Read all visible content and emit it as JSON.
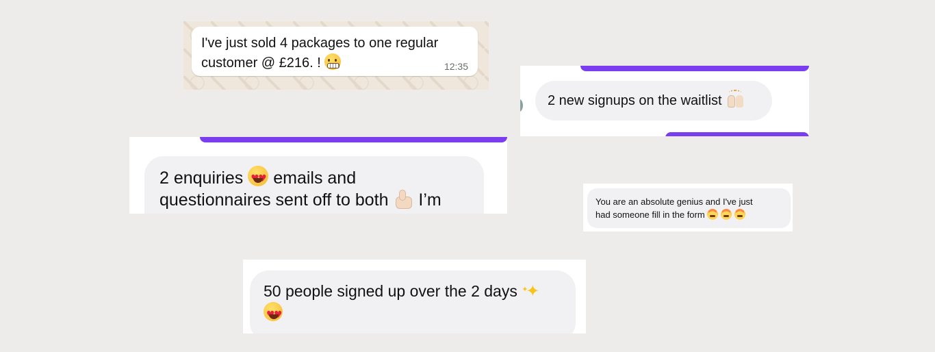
{
  "messages": {
    "whatsapp": {
      "line1": "I've just sold 4 packages to one regular",
      "line2": "customer @ £216. !",
      "emoji": "grimacing-face",
      "time": "12:35"
    },
    "waitlist": {
      "text": "2 new signups on the waitlist",
      "emoji": "raising-hands"
    },
    "enquiries": {
      "line1_a": "2 enquiries",
      "line1_emoji": "heart-eyes-face",
      "line1_b": "emails and",
      "line2_a": "questionnaires sent off to both",
      "line2_emoji": "thumbs-up",
      "line2_b": "I’m"
    },
    "genius": {
      "line1": "You are an absolute genius and I've just",
      "line2": "had someone fill in the form",
      "emoji": "exploding-head",
      "emoji_count": 3
    },
    "signups": {
      "line1": "50 people signed up over the 2 days",
      "line1_emoji": "sparkles",
      "line2_emoji": "heart-eyes-face"
    }
  },
  "colors": {
    "background": "#edecea",
    "bubble": "#f1f1f3",
    "accent_purple": "#7a3ef0",
    "whatsapp_wallpaper": "#efe7dc"
  }
}
